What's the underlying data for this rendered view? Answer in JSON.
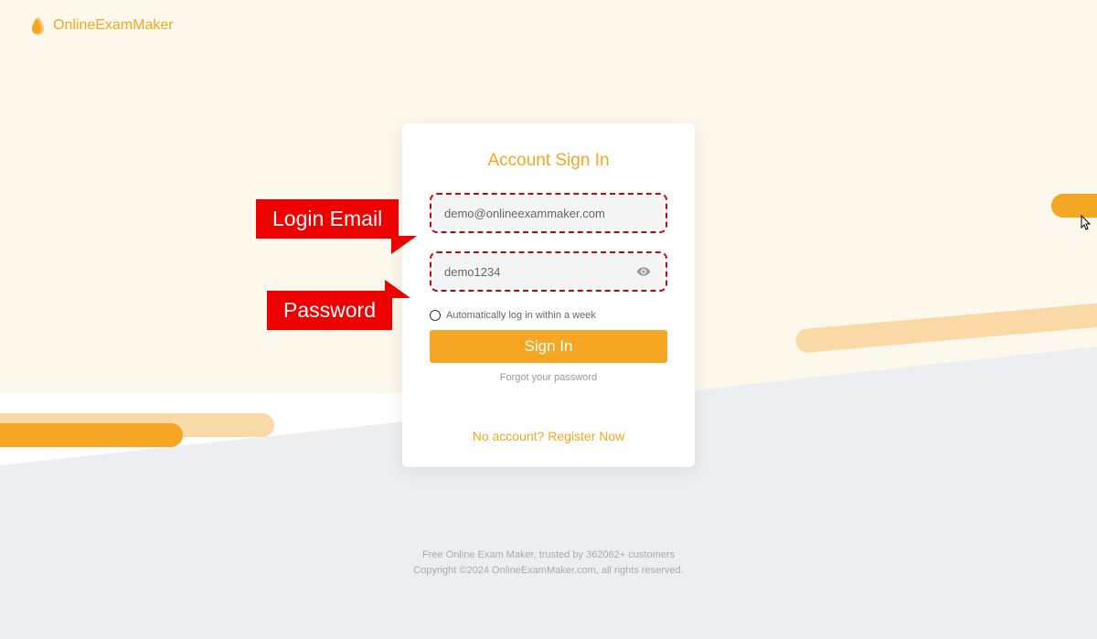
{
  "logo": {
    "text": "OnlineExamMaker"
  },
  "card": {
    "title": "Account Sign In",
    "email_value": "demo@onlineexammaker.com",
    "password_value": "demo1234",
    "remember_label": "Automatically log in within a week",
    "signin_label": "Sign In",
    "forgot_label": "Forgot your password",
    "register_label": "No account? Register Now"
  },
  "callouts": {
    "email": "Login Email",
    "password": "Password"
  },
  "footer": {
    "line1": "Free Online Exam Maker, trusted by 362062+ customers",
    "line2": "Copyright ©2024 OnlineExamMaker.com, all rights reserved."
  }
}
